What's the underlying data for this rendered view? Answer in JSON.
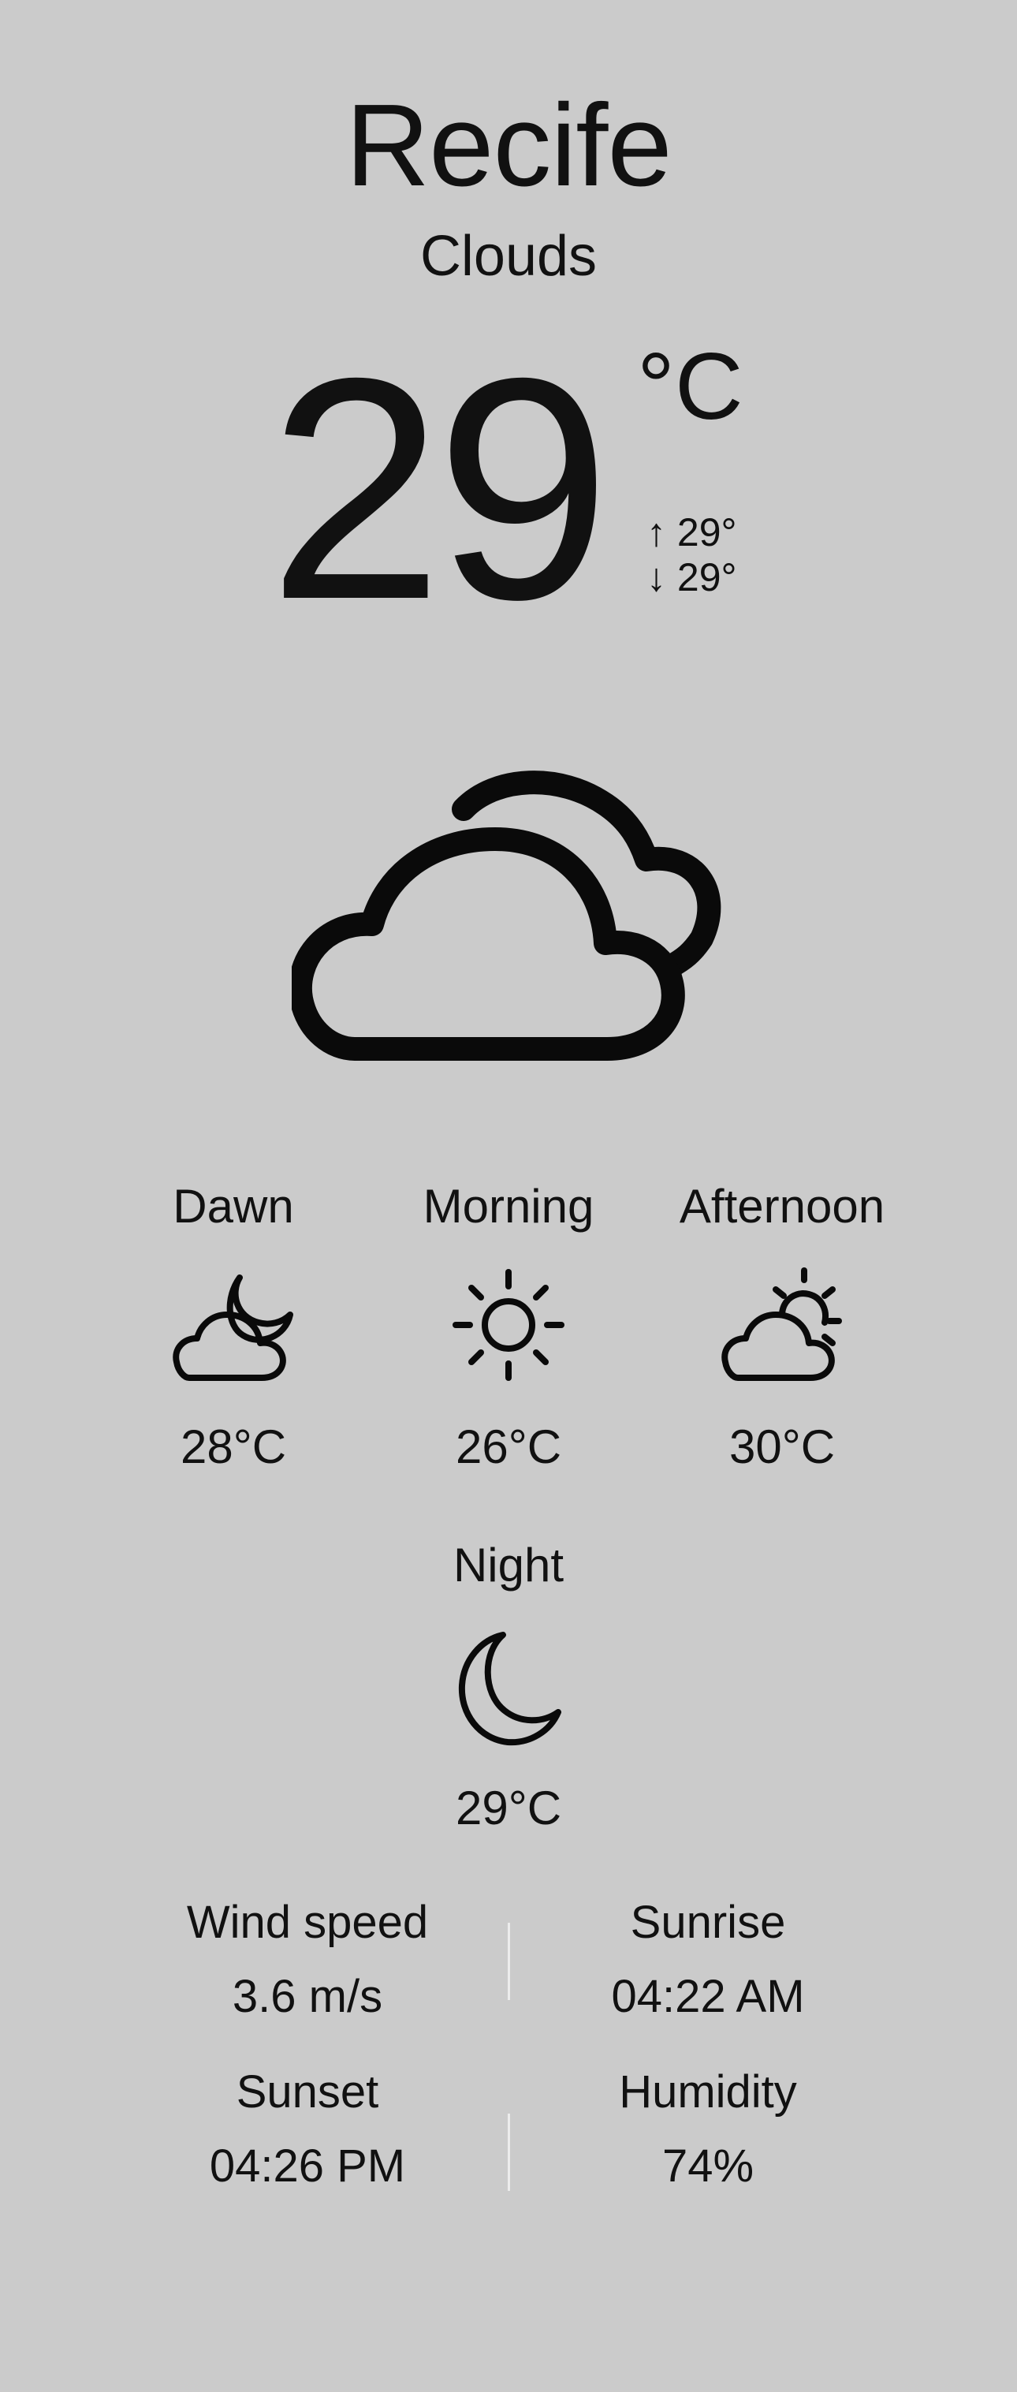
{
  "location": {
    "city": "Recife",
    "condition": "Clouds"
  },
  "current": {
    "temperature": "29",
    "unit": "°C",
    "high": "↑ 29°",
    "low": "↓ 29°",
    "icon": "clouds-icon"
  },
  "periods": [
    {
      "label": "Dawn",
      "temp": "28°C",
      "icon": "cloud-moon-icon"
    },
    {
      "label": "Morning",
      "temp": "26°C",
      "icon": "sun-icon"
    },
    {
      "label": "Afternoon",
      "temp": "30°C",
      "icon": "cloud-sun-icon"
    },
    {
      "label": "Night",
      "temp": "29°C",
      "icon": "moon-icon"
    }
  ],
  "details": {
    "wind_label": "Wind speed",
    "wind_value": "3.6 m/s",
    "sunrise_label": "Sunrise",
    "sunrise_value": "04:22 AM",
    "sunset_label": "Sunset",
    "sunset_value": "04:26 PM",
    "humidity_label": "Humidity",
    "humidity_value": "74%"
  },
  "colors": {
    "background": "#cbcbcb",
    "text": "#111111",
    "divider": "#ececec"
  }
}
